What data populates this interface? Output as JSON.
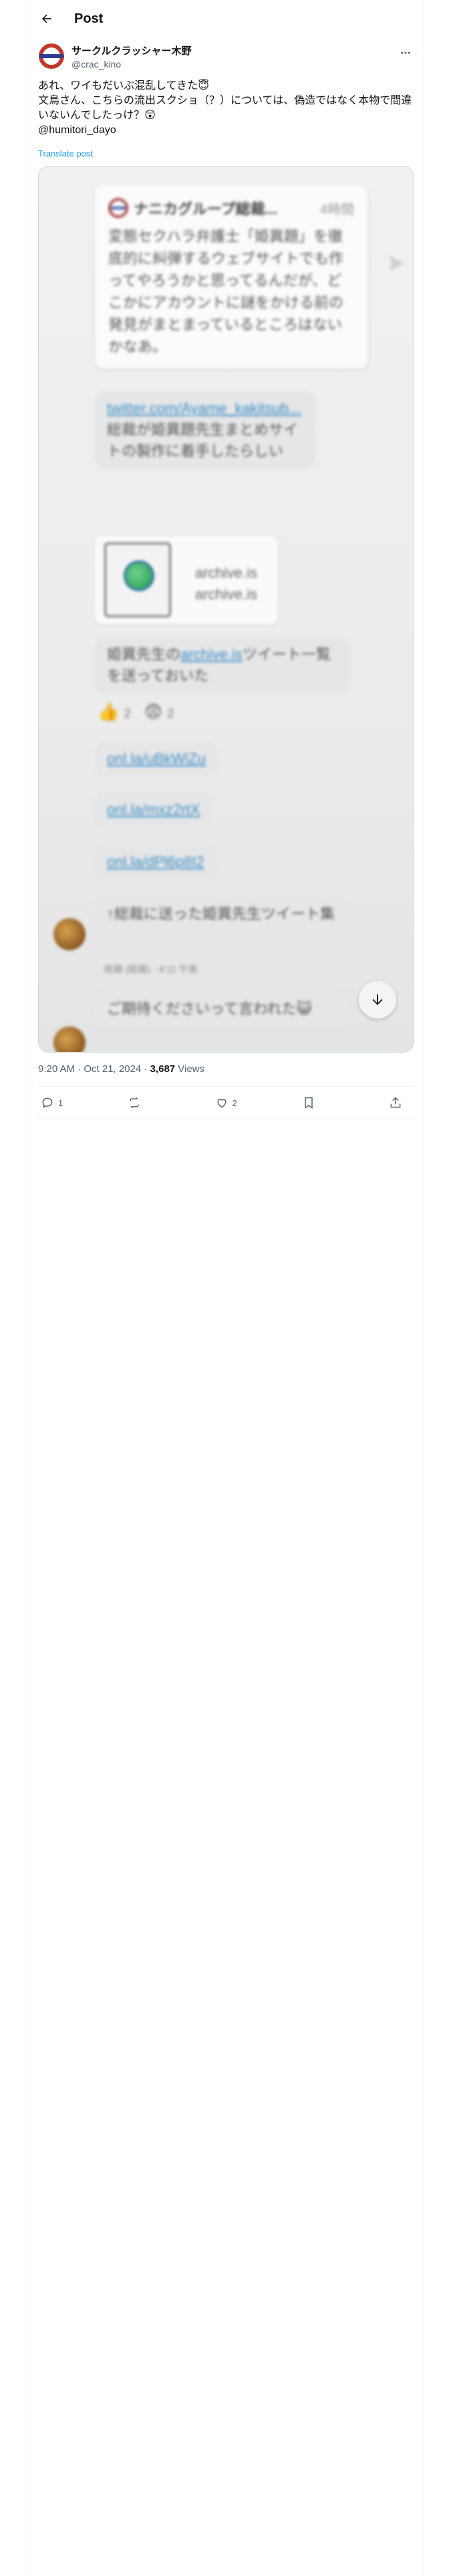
{
  "header": {
    "title": "Post"
  },
  "author": {
    "display_name": "サークルクラッシャー木野",
    "handle": "@crac_kino"
  },
  "tweet": {
    "line1": "あれ、ワイもだいぶ混乱してきた😇",
    "line2": "文鳥さん、こちらの流出スクショ（？）については、偽造ではなく本物で間違いないんでしたっけ？😲",
    "line3": "@humitori_dayo",
    "translate_label": "Translate post"
  },
  "media": {
    "card_title": "ナニカグループ総裁...",
    "card_time": "4時間",
    "card_text": "変態セクハラ弁護士「姫異題」を徹底的に糾弾するウェブサイトでも作ってやろうかと思ってるんだが、どこかにアカウントに謎をかける前の発見がまとまっているところはないかなあ。",
    "bubble1_link": "twitter.com/Ayame_kakitsub...",
    "bubble1_text": "総裁が姫異題先生まとめサイトの製作に着手したらしい",
    "archive_line1": "archive.is",
    "archive_line2": "archive.is",
    "bubble2_pre": "姫異先生の",
    "bubble2_link": "archive.is",
    "bubble2_post": "ツイート一覧を送っておいた",
    "reaction1_count": "2",
    "reaction2_count": "2",
    "link1": "onl.la/uBkWiZu",
    "link2": "onl.la/mxz2rtX",
    "link3": "onl.la/dPl6p8I2",
    "bubble3_text": "↑総裁に送った姫異先生ツイート集",
    "sender_meta": "総裁 (総裁) · 4:11 午後",
    "bubble4_text": "ご期待くださいって言われた😺"
  },
  "meta": {
    "time_date": "9:20 AM · Oct 21, 2024 · ",
    "views_count": "3,687",
    "views_label": " Views"
  },
  "actions": {
    "replies": "1",
    "reposts": "",
    "likes": "2"
  },
  "colors": {
    "link": "#1d9bf0",
    "secondary": "#536471",
    "border": "#eff3f4"
  }
}
